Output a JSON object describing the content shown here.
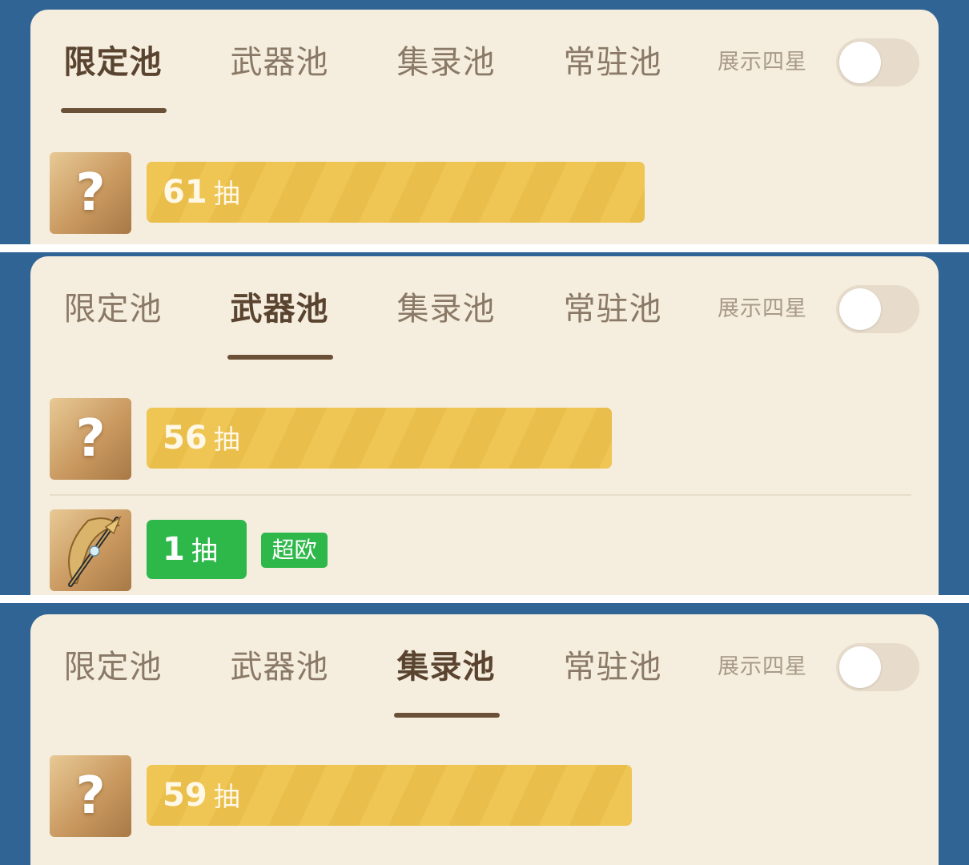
{
  "toggle_label": "展示四星",
  "panels": [
    {
      "tabs": [
        "限定池",
        "武器池",
        "集录池",
        "常驻池"
      ],
      "active_tab": "限定池",
      "records": [
        {
          "icon": "unknown-character-icon",
          "count": "61",
          "unit": "抽"
        }
      ]
    },
    {
      "tabs": [
        "限定池",
        "武器池",
        "集录池",
        "常驻池"
      ],
      "active_tab": "武器池",
      "records": [
        {
          "icon": "unknown-weapon-icon",
          "count": "56",
          "unit": "抽"
        },
        {
          "icon": "bow-weapon-icon",
          "count": "1",
          "unit": "抽",
          "badge": "超欧"
        }
      ]
    },
    {
      "tabs": [
        "限定池",
        "武器池",
        "集录池",
        "常驻池"
      ],
      "active_tab": "集录池",
      "records": [
        {
          "icon": "unknown-character-icon",
          "count": "59",
          "unit": "抽"
        }
      ]
    }
  ],
  "colors": {
    "background": "#2f6495",
    "card": "#f5eddd",
    "progress_bar": "#efc554",
    "lucky": "#2fb84a",
    "active_tab_text": "#5a4430"
  }
}
